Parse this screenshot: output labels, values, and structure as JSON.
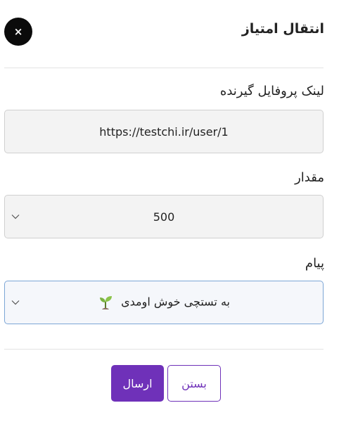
{
  "dialog": {
    "title": "انتقال امتیاز",
    "close_symbol": "×"
  },
  "recipient": {
    "label": "لینک پروفایل گیرنده",
    "value": "https://testchi.ir/user/1"
  },
  "amount": {
    "label": "مقدار",
    "value": "500"
  },
  "message": {
    "label": "پیام",
    "value": "به تستچی خوش اومدی",
    "emoji_icon": "seedling-icon"
  },
  "actions": {
    "send_label": "ارسال",
    "close_label": "بستن"
  },
  "colors": {
    "accent": "#6f31b9",
    "close_button_bg": "#0b0b0b",
    "focus_border": "#7ca6d6"
  }
}
